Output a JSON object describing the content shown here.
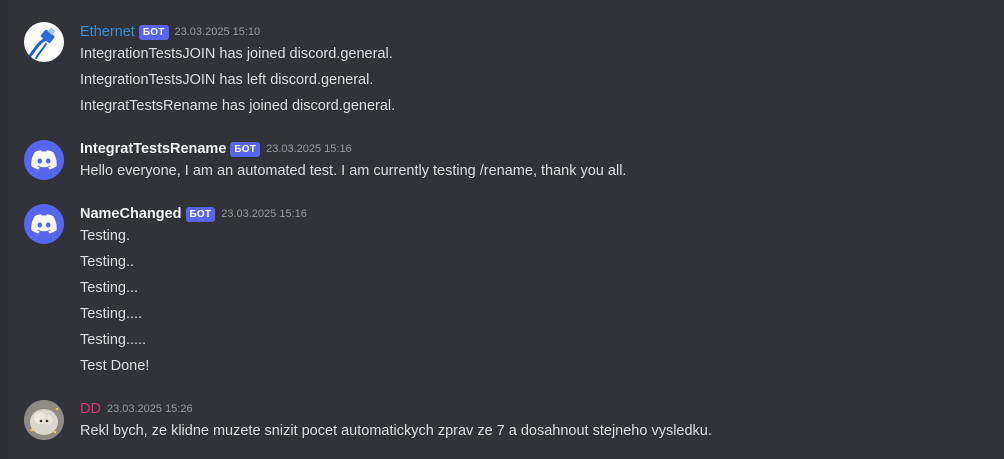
{
  "messages": [
    {
      "author": "Ethernet",
      "bot_tag": "БОТ",
      "timestamp": "23.03.2025 15:10",
      "avatar_icon": "ethernet-cable-icon",
      "lines": [
        "IntegrationTestsJOIN has joined discord.general.",
        "IntegrationTestsJOIN has left discord.general.",
        "IntegratTestsRename has joined discord.general."
      ]
    },
    {
      "author": "IntegratTestsRename",
      "bot_tag": "БОТ",
      "timestamp": "23.03.2025 15:16",
      "avatar_icon": "discord-logo-icon",
      "lines": [
        "Hello everyone, I am an automated test. I am currently testing /rename, thank you all."
      ]
    },
    {
      "author": "NameChanged",
      "bot_tag": "БОТ",
      "timestamp": "23.03.2025 15:16",
      "avatar_icon": "discord-logo-icon",
      "lines": [
        "Testing.",
        "Testing..",
        "Testing...",
        "Testing....",
        "Testing.....",
        "Test Done!"
      ]
    },
    {
      "author": "DD",
      "timestamp": "23.03.2025 15:26",
      "avatar_icon": "user-photo-avatar",
      "lines": [
        "Rekl bych, ze klidne muzete snizit pocet automatickych zprav ze 7 a dosahnout stejneho vysledku."
      ]
    }
  ],
  "colors": {
    "background": "#313338",
    "bot_tag": "#5865f2",
    "ethernet_name": "#3a8fd6",
    "dd_name": "#d9307a",
    "text": "#dbdee1",
    "timestamp": "#949ba4"
  }
}
